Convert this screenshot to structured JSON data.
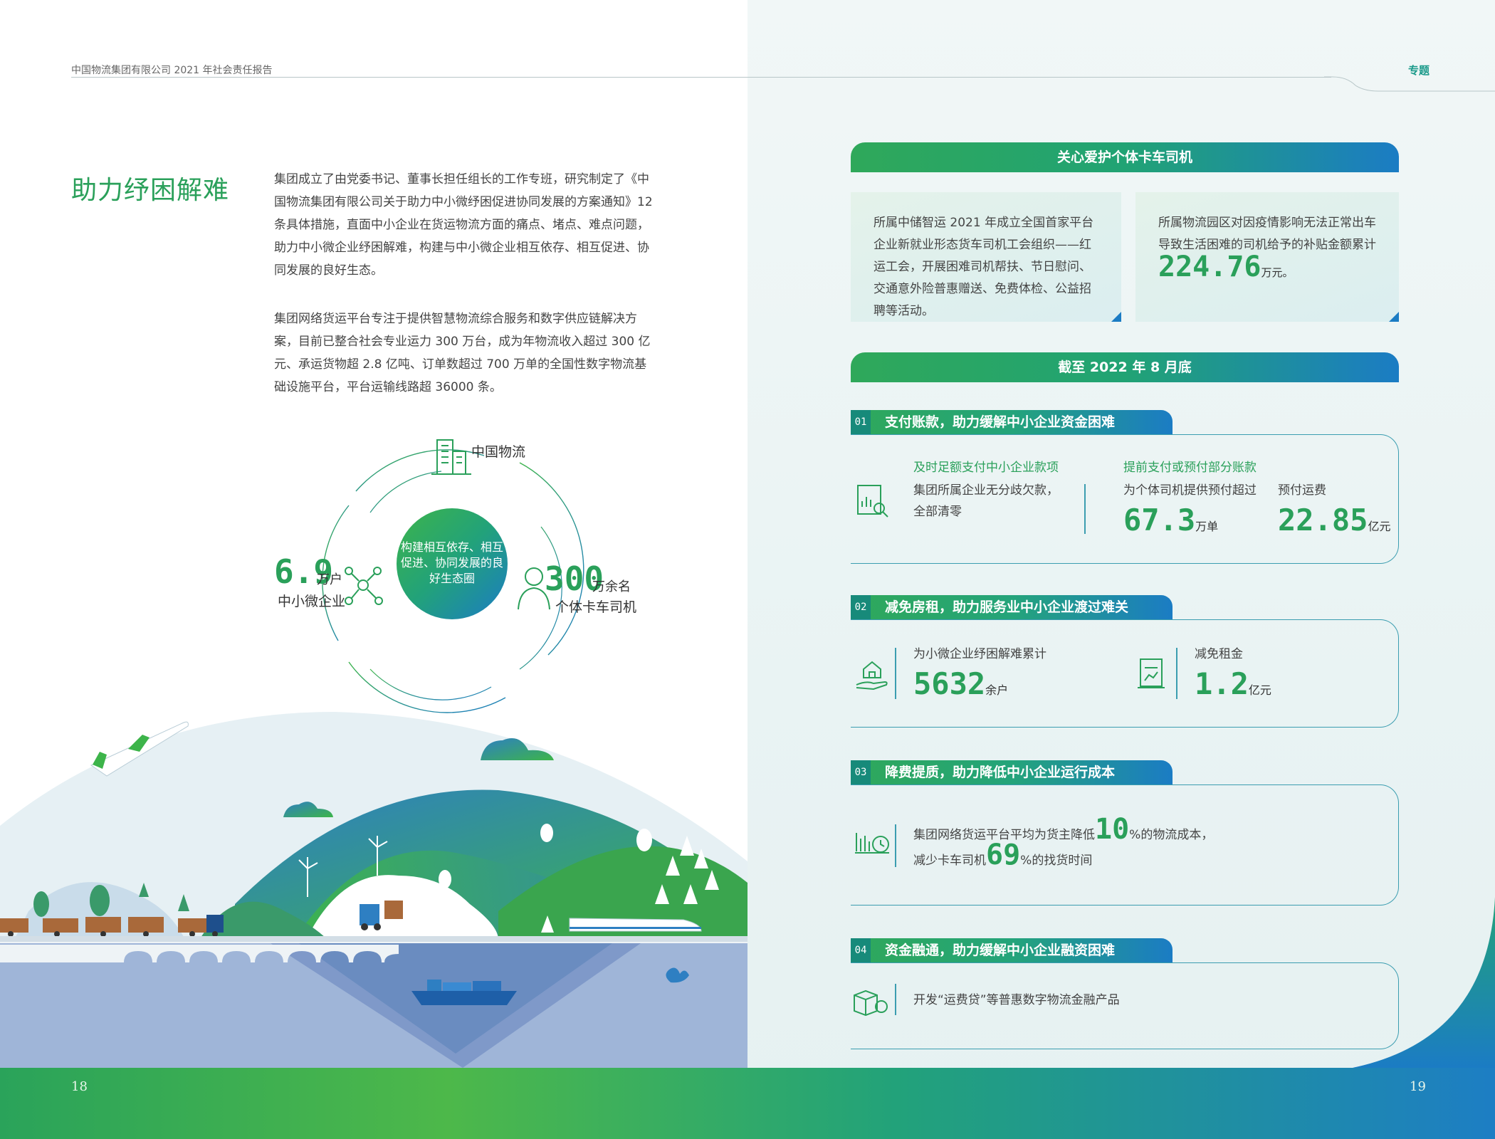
{
  "header": {
    "report_title": "中国物流集团有限公司 2021 年社会责任报告",
    "section_tag": "专题"
  },
  "left": {
    "title": "助力纾困解难",
    "para1": "集团成立了由党委书记、董事长担任组长的工作专班，研究制定了《中国物流集团有限公司关于助力中小微纾困促进协同发展的方案通知》12 条具体措施，直面中小企业在货运物流方面的痛点、堵点、难点问题，助力中小微企业纾困解难，构建与中小微企业相互依存、相互促进、协同发展的良好生态。",
    "para2": "集团网络货运平台专注于提供智慧物流综合服务和数字供应链解决方案，目前已整合社会专业运力 300 万台，成为年物流收入超过 300 亿元、承运货物超 2.8 亿吨、订单数超过 700 万单的全国性数字物流基础设施平台，平台运输线路超 36000 条。",
    "diagram": {
      "top_label": "中国物流",
      "center_text": "构建相互依存、相互促进、协同发展的良好生态圈",
      "left_num": "6.9",
      "left_unit": "万户",
      "left_label": "中小微企业",
      "right_num": "300",
      "right_unit": "万余名",
      "right_label": "个体卡车司机"
    }
  },
  "right": {
    "banner1": "关心爱护个体卡车司机",
    "box1": "所属中储智运 2021 年成立全国首家平台企业新就业形态货车司机工会组织——红运工会，开展困难司机帮扶、节日慰问、交通意外险普惠赠送、免费体检、公益招聘等活动。",
    "box2_text": "所属物流园区对因疫情影响无法正常出车导致生活困难的司机给予的补贴金额累计",
    "box2_num": "224.76",
    "box2_unit": "万元。",
    "banner2": "截至 2022 年 8 月底",
    "items": [
      {
        "num": "01",
        "title": "支付账款，助力缓解中小企业资金困难",
        "sub1_title": "及时足额支付中小企业款项",
        "sub1_text_a": "集团所属企业无分歧欠款，",
        "sub1_text_b": "全部清零",
        "sub2_title": "提前支付或预付部分账款",
        "sub2_label_a": "为个体司机提供预付超过",
        "sub2_num_a": "67.3",
        "sub2_unit_a": "万单",
        "sub2_label_b": "预付运费",
        "sub2_num_b": "22.85",
        "sub2_unit_b": "亿元"
      },
      {
        "num": "02",
        "title": "减免房租，助力服务业中小企业渡过难关",
        "label_a": "为小微企业纾困解难累计",
        "num_a": "5632",
        "unit_a": "余户",
        "label_b": "减免租金",
        "num_b": "1.2",
        "unit_b": "亿元"
      },
      {
        "num": "03",
        "title": "降费提质，助力降低中小企业运行成本",
        "line1_a": "集团网络货运平台平均为货主降低",
        "line1_num": "10",
        "line1_b": "%的物流成本，",
        "line2_a": "减少卡车司机",
        "line2_num": "69",
        "line2_b": "%的找货时间"
      },
      {
        "num": "04",
        "title": "资金融通，助力缓解中小企业融资困难",
        "text": "开发“运费贷”等普惠数字物流金融产品"
      }
    ]
  },
  "footer": {
    "page_left": "18",
    "page_right": "19"
  },
  "colors": {
    "green": "#2aa05a",
    "teal": "#1a9a8a",
    "blue": "#1b7cc4"
  }
}
